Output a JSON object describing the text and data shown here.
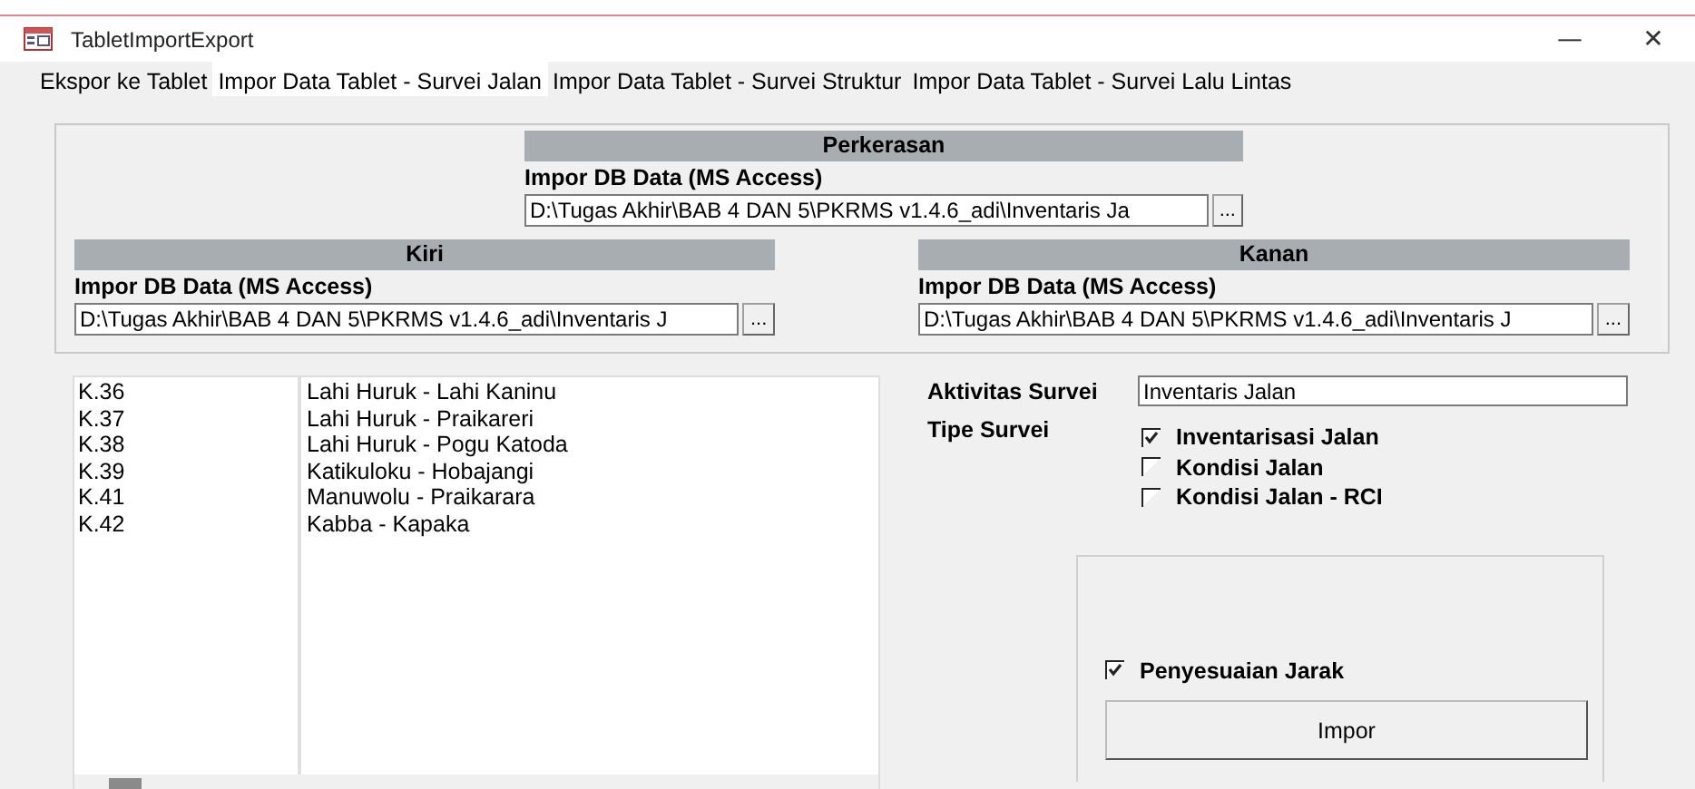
{
  "window": {
    "title": "TabletImportExport",
    "minimize": "—",
    "close": "✕"
  },
  "tabs": [
    {
      "label": "Ekspor ke Tablet",
      "selected": false
    },
    {
      "label": "Impor Data Tablet - Survei Jalan",
      "selected": true
    },
    {
      "label": "Impor Data Tablet - Survei Struktur",
      "selected": false
    },
    {
      "label": "Impor Data Tablet - Survei Lalu Lintas",
      "selected": false
    }
  ],
  "perkerasan": {
    "header": "Perkerasan",
    "label": "Impor DB Data (MS Access)",
    "path": "D:\\Tugas Akhir\\BAB 4 DAN 5\\PKRMS v1.4.6_adi\\Inventaris Ja",
    "browse": "..."
  },
  "kiri": {
    "header": "Kiri",
    "label": "Impor DB Data (MS Access)",
    "path": "D:\\Tugas Akhir\\BAB 4 DAN 5\\PKRMS v1.4.6_adi\\Inventaris J",
    "browse": "..."
  },
  "kanan": {
    "header": "Kanan",
    "label": "Impor DB Data (MS Access)",
    "path": "D:\\Tugas Akhir\\BAB 4 DAN 5\\PKRMS v1.4.6_adi\\Inventaris J",
    "browse": "..."
  },
  "list": {
    "rows": [
      {
        "code": "K.36",
        "name": "Lahi Huruk - Lahi Kaninu"
      },
      {
        "code": "K.37",
        "name": "Lahi Huruk - Praikareri"
      },
      {
        "code": "K.38",
        "name": "Lahi Huruk - Pogu Katoda"
      },
      {
        "code": "K.39",
        "name": "Katikuloku - Hobajangi"
      },
      {
        "code": "K.41",
        "name": "Manuwolu - Praikarara"
      },
      {
        "code": "K.42",
        "name": "Kabba - Kapaka"
      }
    ]
  },
  "form": {
    "activity_label": "Aktivitas Survei",
    "activity_value": "Inventaris Jalan",
    "type_label": "Tipe Survei",
    "types": [
      {
        "label": "Inventarisasi Jalan",
        "checked": true
      },
      {
        "label": "Kondisi Jalan",
        "checked": false
      },
      {
        "label": "Kondisi Jalan - RCI",
        "checked": false
      }
    ]
  },
  "import_panel": {
    "distance_adjust": {
      "label": "Penyesuaian Jarak",
      "checked": true
    },
    "button": "Impor"
  }
}
